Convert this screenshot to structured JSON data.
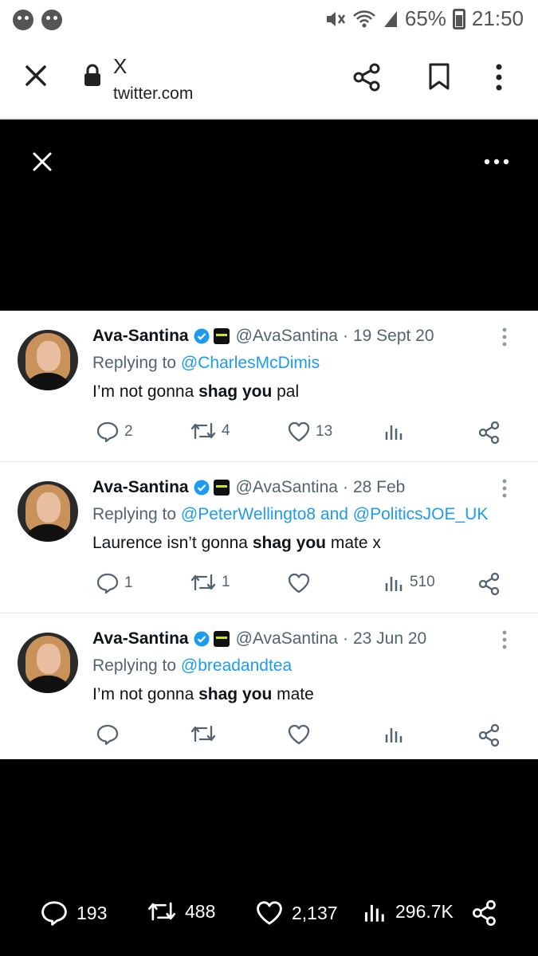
{
  "status_bar": {
    "battery": "65%",
    "time": "21:50"
  },
  "browser": {
    "title": "X",
    "domain": "twitter.com"
  },
  "tweets": [
    {
      "name": "Ava-Santina",
      "handle": "@AvaSantina",
      "date": "19 Sept 20",
      "replying_prefix": "Replying to",
      "replying_to": "@CharlesMcDimis",
      "text": {
        "pre": "I’m not gonna ",
        "bold": "shag you",
        "post": " pal"
      },
      "replies": "2",
      "retweets": "4",
      "likes": "13",
      "views": ""
    },
    {
      "name": "Ava-Santina",
      "handle": "@AvaSantina",
      "date": "28 Feb",
      "replying_prefix": "Replying to",
      "replying_to": "@PeterWellingto8 and @PoliticsJOE_UK",
      "text": {
        "pre": "Laurence isn’t gonna ",
        "bold": "shag you",
        "post": " mate x"
      },
      "replies": "1",
      "retweets": "1",
      "likes": "",
      "views": "510"
    },
    {
      "name": "Ava-Santina",
      "handle": "@AvaSantina",
      "date": "23 Jun 20",
      "replying_prefix": "Replying to",
      "replying_to": "@breadandtea",
      "text": {
        "pre": "I’m not gonna ",
        "bold": "shag you",
        "post": " mate"
      },
      "replies": "",
      "retweets": "",
      "likes": "",
      "views": ""
    }
  ],
  "bottom_bar": {
    "replies": "193",
    "retweets": "488",
    "likes": "2,137",
    "views": "296.7K"
  },
  "colors": {
    "link": "#1d9bf0",
    "muted": "#536471",
    "verified": "#1d9bf0"
  },
  "icons": [
    "close-icon",
    "lock-icon",
    "share-icon",
    "bookmark-icon",
    "more-vertical-icon",
    "more-horizontal-icon",
    "reply-icon",
    "retweet-icon",
    "like-icon",
    "views-icon",
    "verified-icon"
  ]
}
